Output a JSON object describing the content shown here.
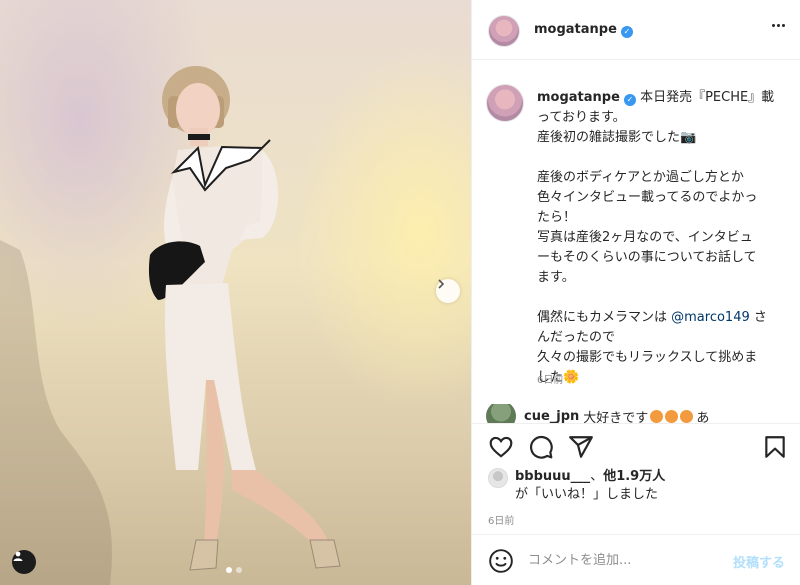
{
  "post": {
    "username": "mogatanpe",
    "caption_lines": [
      "本日発売『PECHE』載",
      "っております。",
      "産後初の雑誌撮影でした📷",
      "",
      "産後のボディケアとか過ごし方とか",
      "色々インタビュー載ってるのでよかっ",
      "たら！",
      "写真は産後2ヶ月なので、インタビュ",
      "ーもそのくらいの事についてお話して",
      "ます。",
      ""
    ],
    "caption_mention_prefix": "偶然にもカメラマンは ",
    "caption_mention": "@marco149",
    "caption_mention_suffix": " さ",
    "caption_tail_lines": [
      "んだったので",
      "久々の撮影でもリラックスして挑めま",
      "した🌼"
    ],
    "caption_time": "6日前",
    "comment": {
      "username": "cue_jpn",
      "text": "大好きです",
      "suffix": "あ"
    },
    "likes": {
      "user": "bbbuuu___",
      "separator": "、",
      "others": "他1.9万人",
      "line2": "が「いいね！」しました"
    },
    "post_time": "6日前",
    "comment_input": {
      "placeholder": "コメントを追加...",
      "post_label": "投稿する"
    },
    "carousel": {
      "count": 2,
      "active": 1
    }
  },
  "icons": {
    "verified": "verified-badge-icon",
    "more": "more-options-icon",
    "like": "heart-icon",
    "comment": "comment-icon",
    "share": "share-icon",
    "save": "bookmark-icon",
    "emoji": "smile-icon",
    "next": "chevron-right-icon",
    "tag": "user-tag-icon"
  },
  "colors": {
    "verified": "#3897f0",
    "link": "#00376b",
    "post_disabled": "#b2dffc",
    "muted": "#8e8e8e"
  }
}
